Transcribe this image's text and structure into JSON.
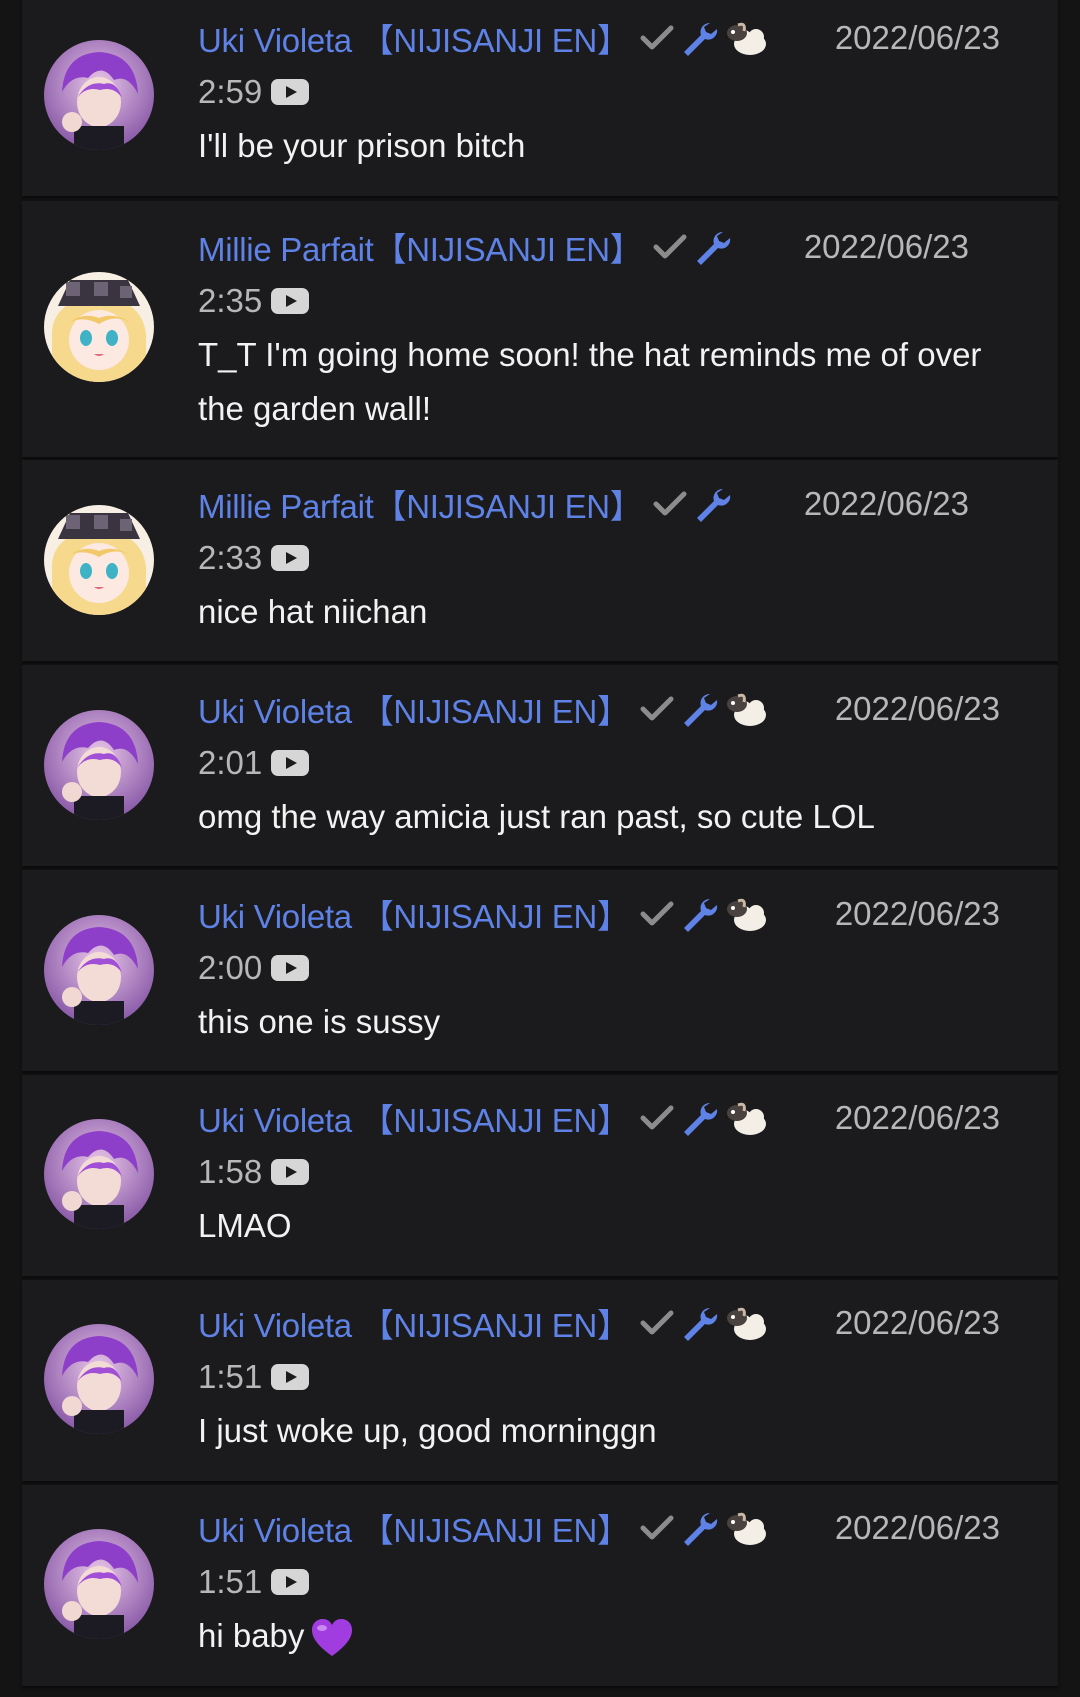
{
  "colors": {
    "background": "#141414",
    "card": "#1b1b1d",
    "author": "#5f82e6",
    "meta": "#b7b7b7",
    "text": "#f2f2f2",
    "check": "#8c8c8c",
    "wrench": "#5f82e6"
  },
  "icons": [
    "check-icon",
    "wrench-icon",
    "sheep-badge-icon",
    "youtube-icon",
    "purple-heart-emoji"
  ],
  "comments": [
    {
      "author": "Uki Violeta 【NIJISANJI EN】",
      "date": "2022/06/23",
      "time": "2:59",
      "text": "I'll be your prison bitch",
      "avatar": "uki-avatar",
      "badge": true
    },
    {
      "author": "Millie Parfait【NIJISANJI EN】",
      "date": "2022/06/23",
      "time": "2:35",
      "text": "T_T I'm going home soon! the hat reminds me of over the garden wall!",
      "avatar": "millie-avatar",
      "badge": false
    },
    {
      "author": "Millie Parfait【NIJISANJI EN】",
      "date": "2022/06/23",
      "time": "2:33",
      "text": "nice hat niichan",
      "avatar": "millie-avatar",
      "badge": false
    },
    {
      "author": "Uki Violeta 【NIJISANJI EN】",
      "date": "2022/06/23",
      "time": "2:01",
      "text": "omg the way amicia just ran past, so cute LOL",
      "avatar": "uki-avatar",
      "badge": true
    },
    {
      "author": "Uki Violeta 【NIJISANJI EN】",
      "date": "2022/06/23",
      "time": "2:00",
      "text": "this one is sussy",
      "avatar": "uki-avatar",
      "badge": true
    },
    {
      "author": "Uki Violeta 【NIJISANJI EN】",
      "date": "2022/06/23",
      "time": "1:58",
      "text": "LMAO",
      "avatar": "uki-avatar",
      "badge": true
    },
    {
      "author": "Uki Violeta 【NIJISANJI EN】",
      "date": "2022/06/23",
      "time": "1:51",
      "text": "I just woke up, good morninggn",
      "avatar": "uki-avatar",
      "badge": true
    },
    {
      "author": "Uki Violeta 【NIJISANJI EN】",
      "date": "2022/06/23",
      "time": "1:51",
      "text": "hi baby",
      "avatar": "uki-avatar",
      "badge": true
    }
  ]
}
